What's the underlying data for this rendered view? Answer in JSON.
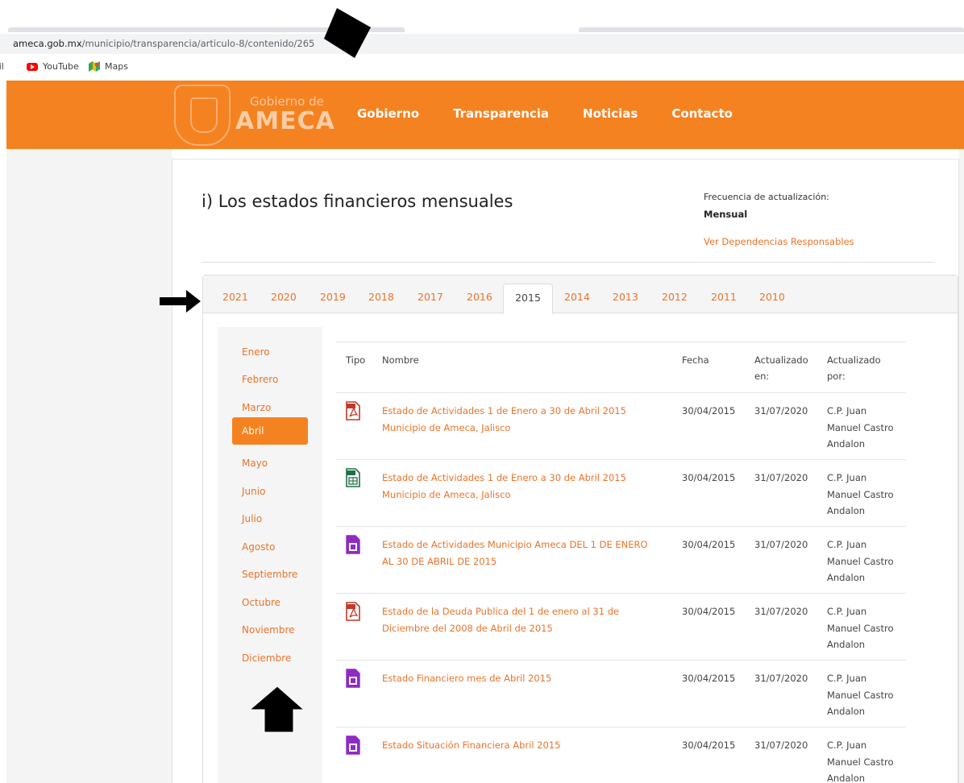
{
  "browser": {
    "url_host": "ameca.gob.mx",
    "url_path": "/municipio/transparencia/articulo-8/contenido/265",
    "bookmarks": [
      {
        "label": "ail"
      },
      {
        "label": "YouTube",
        "icon": "youtube-icon"
      },
      {
        "label": "Maps",
        "icon": "maps-icon"
      }
    ]
  },
  "header": {
    "logo_sub": "Gobierno de",
    "logo_main": "AMECA",
    "nav": [
      "Gobierno",
      "Transparencia",
      "Noticias",
      "Contacto"
    ],
    "color": "#f58220"
  },
  "page": {
    "title": "i) Los estados financieros mensuales",
    "freq_label": "Frecuencia de actualización:",
    "freq_value": "Mensual",
    "deps_link": "Ver Dependencias Responsables"
  },
  "years": {
    "items": [
      "2021",
      "2020",
      "2019",
      "2018",
      "2017",
      "2016",
      "2015",
      "2014",
      "2013",
      "2012",
      "2011",
      "2010"
    ],
    "active": "2015"
  },
  "months": {
    "items": [
      "Enero",
      "Febrero",
      "Marzo",
      "Abril",
      "Mayo",
      "Junio",
      "Julio",
      "Agosto",
      "Septiembre",
      "Octubre",
      "Noviembre",
      "Diciembre"
    ],
    "active": "Abril"
  },
  "table": {
    "headers": {
      "tipo": "Tipo",
      "nombre": "Nombre",
      "fecha": "Fecha",
      "actualizado_en": "Actualizado en:",
      "actualizado_por": "Actualizado por:"
    },
    "rows": [
      {
        "tipo": "pdf",
        "nombre": "Estado de Actividades 1 de Enero a 30 de Abril 2015 Municipio de Ameca, Jalisco",
        "fecha": "30/04/2015",
        "actualizado_en": "31/07/2020",
        "actualizado_por": "C.P. Juan Manuel Castro Andalon"
      },
      {
        "tipo": "xls",
        "nombre": "Estado de Actividades 1 de Enero a 30 de Abril 2015 Municipio de Ameca, Jalisco",
        "fecha": "30/04/2015",
        "actualizado_en": "31/07/2020",
        "actualizado_por": "C.P. Juan Manuel Castro Andalon"
      },
      {
        "tipo": "doc",
        "nombre": "Estado de Actividades Municipio Ameca DEL 1 DE ENERO AL 30 DE ABRIL DE 2015",
        "fecha": "30/04/2015",
        "actualizado_en": "31/07/2020",
        "actualizado_por": "C.P. Juan Manuel Castro Andalon"
      },
      {
        "tipo": "pdf",
        "nombre": "Estado de la Deuda Publica del 1 de enero al 31 de Diciembre del 2008 de Abril de 2015",
        "fecha": "30/04/2015",
        "actualizado_en": "31/07/2020",
        "actualizado_por": "C.P. Juan Manuel Castro Andalon"
      },
      {
        "tipo": "doc",
        "nombre": "Estado Financiero mes de Abril 2015",
        "fecha": "30/04/2015",
        "actualizado_en": "31/07/2020",
        "actualizado_por": "C.P. Juan Manuel Castro Andalon"
      },
      {
        "tipo": "doc",
        "nombre": "Estado Situación Financiera Abril 2015",
        "fecha": "30/04/2015",
        "actualizado_en": "31/07/2020",
        "actualizado_por": "C.P. Juan Manuel Castro Andalon"
      }
    ]
  },
  "colors": {
    "accent": "#f58220",
    "link": "#e8742a",
    "pdf": "#c0392b",
    "xls": "#1e7145",
    "doc": "#8e2bc2"
  }
}
